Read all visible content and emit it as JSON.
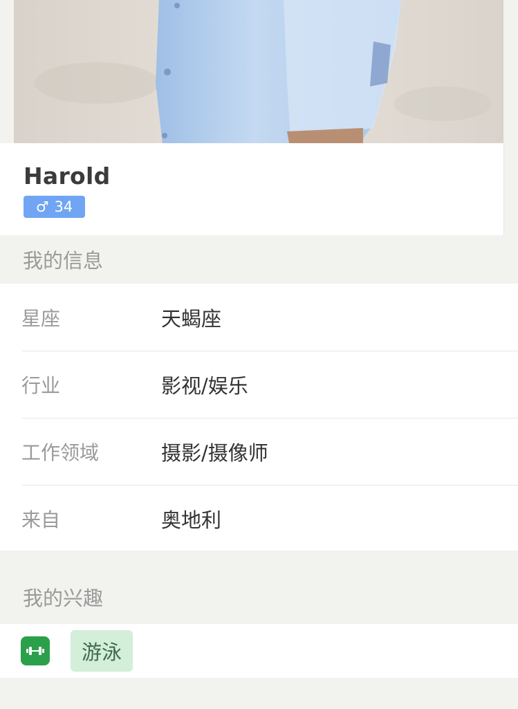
{
  "profile": {
    "name": "Harold",
    "gender_symbol": "♂",
    "age": "34",
    "badge_color": "#6fa5f3"
  },
  "sections": {
    "info_title": "我的信息",
    "interests_title": "我的兴趣"
  },
  "info": [
    {
      "label": "星座",
      "value": "天蝎座"
    },
    {
      "label": "行业",
      "value": "影视/娱乐"
    },
    {
      "label": "工作领域",
      "value": "摄影/摄像师"
    },
    {
      "label": "来自",
      "value": "奥地利"
    }
  ],
  "interests": [
    {
      "icon": "dumbbell-icon",
      "label": "游泳",
      "icon_color": "#2aa04a",
      "tag_color": "#d3eed9"
    }
  ]
}
